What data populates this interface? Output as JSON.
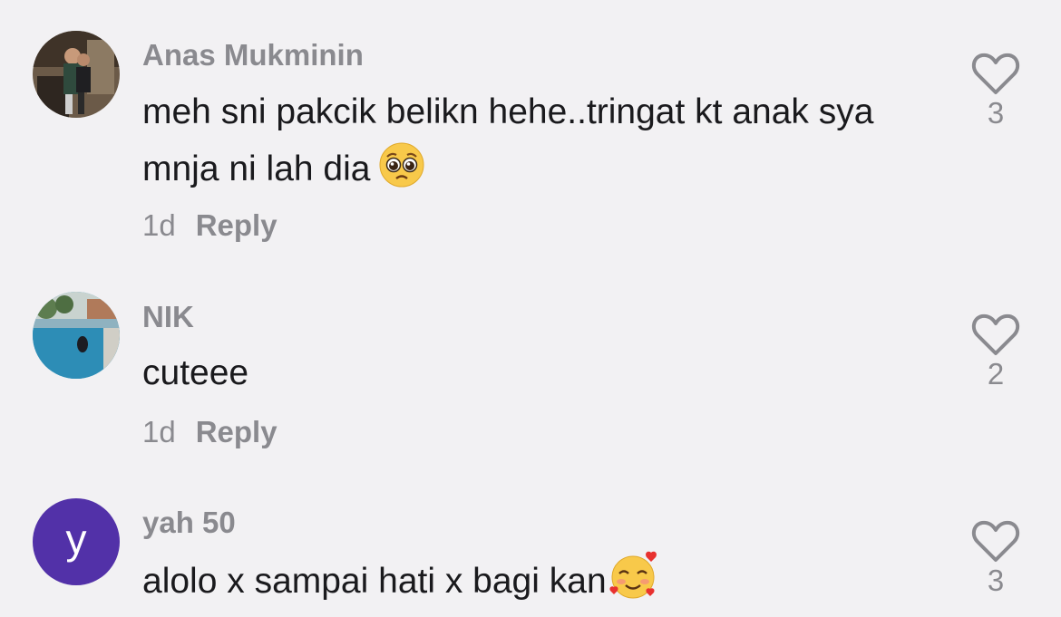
{
  "comments": [
    {
      "username": "Anas Mukminin",
      "text": "meh sni pakcik belikn hehe..tringat kt anak sya mnja ni lah dia",
      "emoji": "pleading-face",
      "time": "1d",
      "reply_label": "Reply",
      "likes": "3"
    },
    {
      "username": "NIK",
      "text": "cuteee",
      "time": "1d",
      "reply_label": "Reply",
      "likes": "2"
    },
    {
      "username": "yah 50",
      "avatar_letter": "y",
      "text": "alolo x sampai hati x bagi kan",
      "emoji": "smiling-face-with-hearts",
      "likes": "3"
    }
  ],
  "colors": {
    "background": "#f2f1f3",
    "username": "#8a8a8f",
    "text": "#1a1a1d",
    "avatar_letter_bg": "#5231a8"
  }
}
